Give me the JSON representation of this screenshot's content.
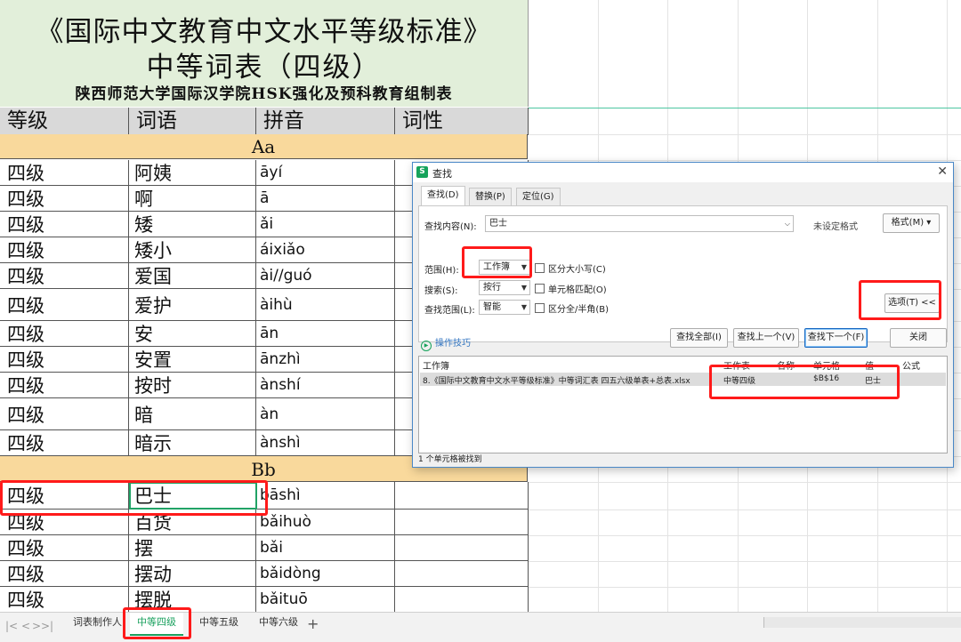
{
  "title_block": {
    "line1": "《国际中文教育中文水平等级标准》",
    "line2": "中等词表（四级）",
    "line3": "陕西师范大学国际汉学院HSK强化及预科教育组制表"
  },
  "columns": [
    "等级",
    "词语",
    "拼音",
    "词性"
  ],
  "bands": {
    "a": "Aa",
    "b": "Bb"
  },
  "rows_a": [
    {
      "level": "四级",
      "word": "阿姨",
      "pinyin": "āyí"
    },
    {
      "level": "四级",
      "word": "啊",
      "pinyin": "ā"
    },
    {
      "level": "四级",
      "word": "矮",
      "pinyin": "ǎi"
    },
    {
      "level": "四级",
      "word": "矮小",
      "pinyin": "áixiǎo"
    },
    {
      "level": "四级",
      "word": "爱国",
      "pinyin": "ài//guó"
    },
    {
      "level": "四级",
      "word": "爱护",
      "pinyin": "àihù"
    },
    {
      "level": "四级",
      "word": "安",
      "pinyin": "ān"
    },
    {
      "level": "四级",
      "word": "安置",
      "pinyin": "ānzhì"
    },
    {
      "level": "四级",
      "word": "按时",
      "pinyin": "ànshí"
    },
    {
      "level": "四级",
      "word": "暗",
      "pinyin": "àn"
    },
    {
      "level": "四级",
      "word": "暗示",
      "pinyin": "ànshì"
    }
  ],
  "rows_b": [
    {
      "level": "四级",
      "word": "巴士",
      "pinyin": "bāshì"
    },
    {
      "level": "四级",
      "word": "百货",
      "pinyin": "bǎihuò"
    },
    {
      "level": "四级",
      "word": "摆",
      "pinyin": "bǎi"
    },
    {
      "level": "四级",
      "word": "摆动",
      "pinyin": "bǎidòng"
    },
    {
      "level": "四级",
      "word": "摆脱",
      "pinyin": "bǎituō"
    }
  ],
  "sheet_tabs": [
    "词表制作人",
    "中等四级",
    "中等五级",
    "中等六级"
  ],
  "active_tab": "中等四级",
  "find_dialog": {
    "title": "查找",
    "tabs": [
      "查找(D)",
      "替换(P)",
      "定位(G)"
    ],
    "find_label": "查找内容(N):",
    "find_value": "巴士",
    "no_format": "未设定格式",
    "format_button": "格式(M)",
    "scope_label": "范围(H):",
    "scope_value": "工作簿",
    "search_label": "搜索(S):",
    "search_value": "按行",
    "lookin_label": "查找范围(L):",
    "lookin_value": "智能",
    "match_case": "区分大小写(C)",
    "match_cell": "单元格匹配(O)",
    "match_width": "区分全/半角(B)",
    "options_button": "选项(T) <<",
    "tips_link": "操作技巧",
    "find_all": "查找全部(I)",
    "find_prev": "查找上一个(V)",
    "find_next": "查找下一个(F)",
    "close": "关闭",
    "result_headers": [
      "工作簿",
      "工作表",
      "名称",
      "单元格",
      "值",
      "公式"
    ],
    "result_row": {
      "workbook": "8.《国际中文教育中文水平等级标准》中等词汇表 四五六级单表+总表.xlsx",
      "sheet": "中等四级",
      "name": "",
      "cell": "$B$16",
      "value": "巴士",
      "formula": ""
    },
    "status": "1 个单元格被找到"
  },
  "colors": {
    "title_bg": "#e2efda",
    "header_bg": "#d9d9d9",
    "band_bg": "#f9d99c",
    "highlight_red": "#ff1a1a",
    "active_green": "#21a366"
  }
}
